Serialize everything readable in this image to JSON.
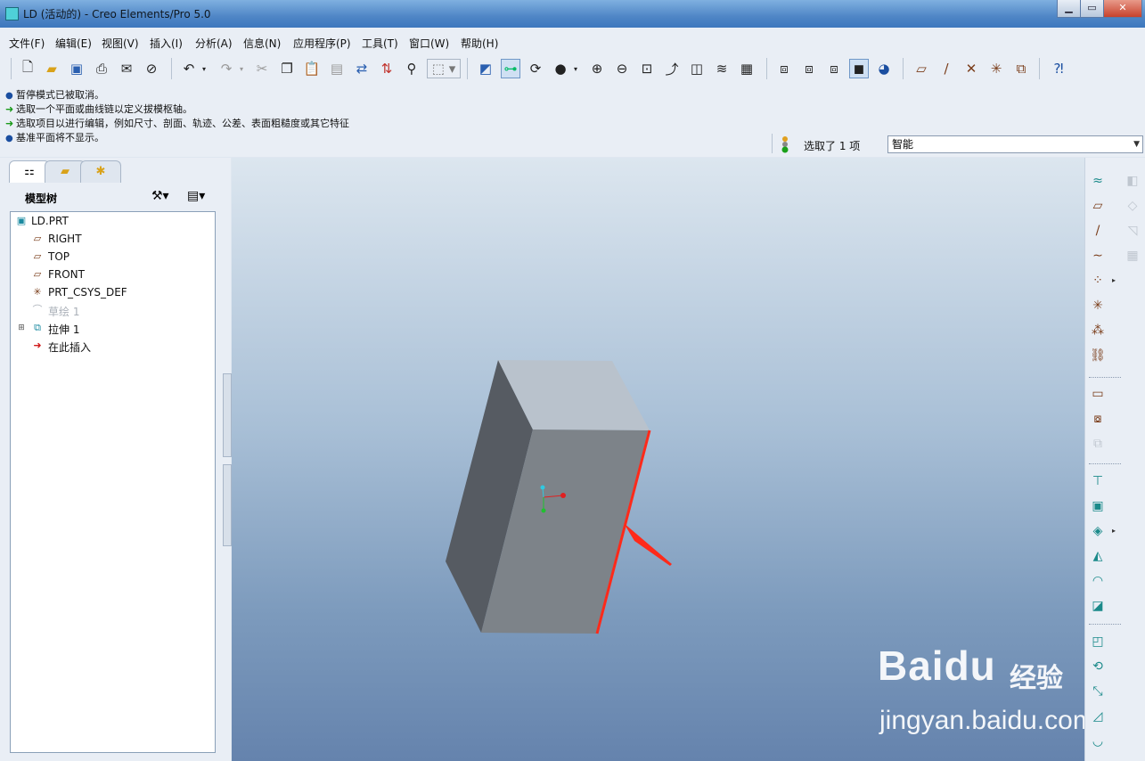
{
  "window": {
    "title": "LD (活动的) - Creo Elements/Pro 5.0",
    "minimize": "▁",
    "maximize": "▭",
    "close": "✕"
  },
  "menu": [
    "文件(F)",
    "编辑(E)",
    "视图(V)",
    "插入(I)",
    "分析(A)",
    "信息(N)",
    "应用程序(P)",
    "工具(T)",
    "窗口(W)",
    "帮助(H)"
  ],
  "toolbar_icons": [
    "new-icon",
    "open-icon",
    "save-icon",
    "print-icon",
    "send-mail-icon",
    "send-link-icon",
    "undo-icon",
    "redo-icon",
    "cut-icon",
    "copy-icon",
    "paste-icon",
    "paste-special-icon",
    "regenerate-icon",
    "regen-manager-icon",
    "find-icon",
    "select-box-icon",
    "redraw-icon",
    "spin-center-icon",
    "orient-mode-icon",
    "appearance-icon",
    "zoom-in-icon",
    "zoom-out-icon",
    "refit-icon",
    "reorient-icon",
    "saved-views-icon",
    "layers-icon",
    "view-manager-icon",
    "wireframe-icon",
    "hidden-line-icon",
    "no-hidden-icon",
    "shading-icon",
    "enhanced-realism-icon",
    "datum-planes-display-icon",
    "datum-axes-display-icon",
    "point-display-icon",
    "csys-display-icon",
    "annotation-display-icon",
    "context-help-icon"
  ],
  "messages": [
    {
      "icon": "bullet",
      "text": "暂停模式已被取消。"
    },
    {
      "icon": "arrow",
      "text": "选取一个平面或曲线链以定义拔模枢轴。"
    },
    {
      "icon": "arrow",
      "text": "选取项目以进行编辑，例如尺寸、剖面、轨迹、公差、表面粗糙度或其它特征"
    },
    {
      "icon": "bullet",
      "text": "基准平面将不显示。"
    }
  ],
  "selection": {
    "status": "选取了 1 项",
    "filter": "智能"
  },
  "model_tree": {
    "header": "模型树",
    "items": [
      {
        "label": "LD.PRT",
        "icon": "part-icon"
      },
      {
        "label": "RIGHT",
        "icon": "datum-plane-icon"
      },
      {
        "label": "TOP",
        "icon": "datum-plane-icon"
      },
      {
        "label": "FRONT",
        "icon": "datum-plane-icon"
      },
      {
        "label": "PRT_CSYS_DEF",
        "icon": "csys-icon"
      },
      {
        "label": "草绘 1",
        "icon": "sketch-icon"
      },
      {
        "label": "拉伸 1",
        "icon": "extrude-icon"
      },
      {
        "label": "在此插入",
        "icon": "insert-here-icon"
      }
    ]
  },
  "watermark": {
    "brand": "Baidu",
    "cn": "经验",
    "url": "jingyan.baidu.com"
  },
  "colors": {
    "highlight_edge": "#ff2a1a",
    "box_front": "#7d8389",
    "box_side": "#565b62",
    "box_top": "#b9c2cc"
  }
}
